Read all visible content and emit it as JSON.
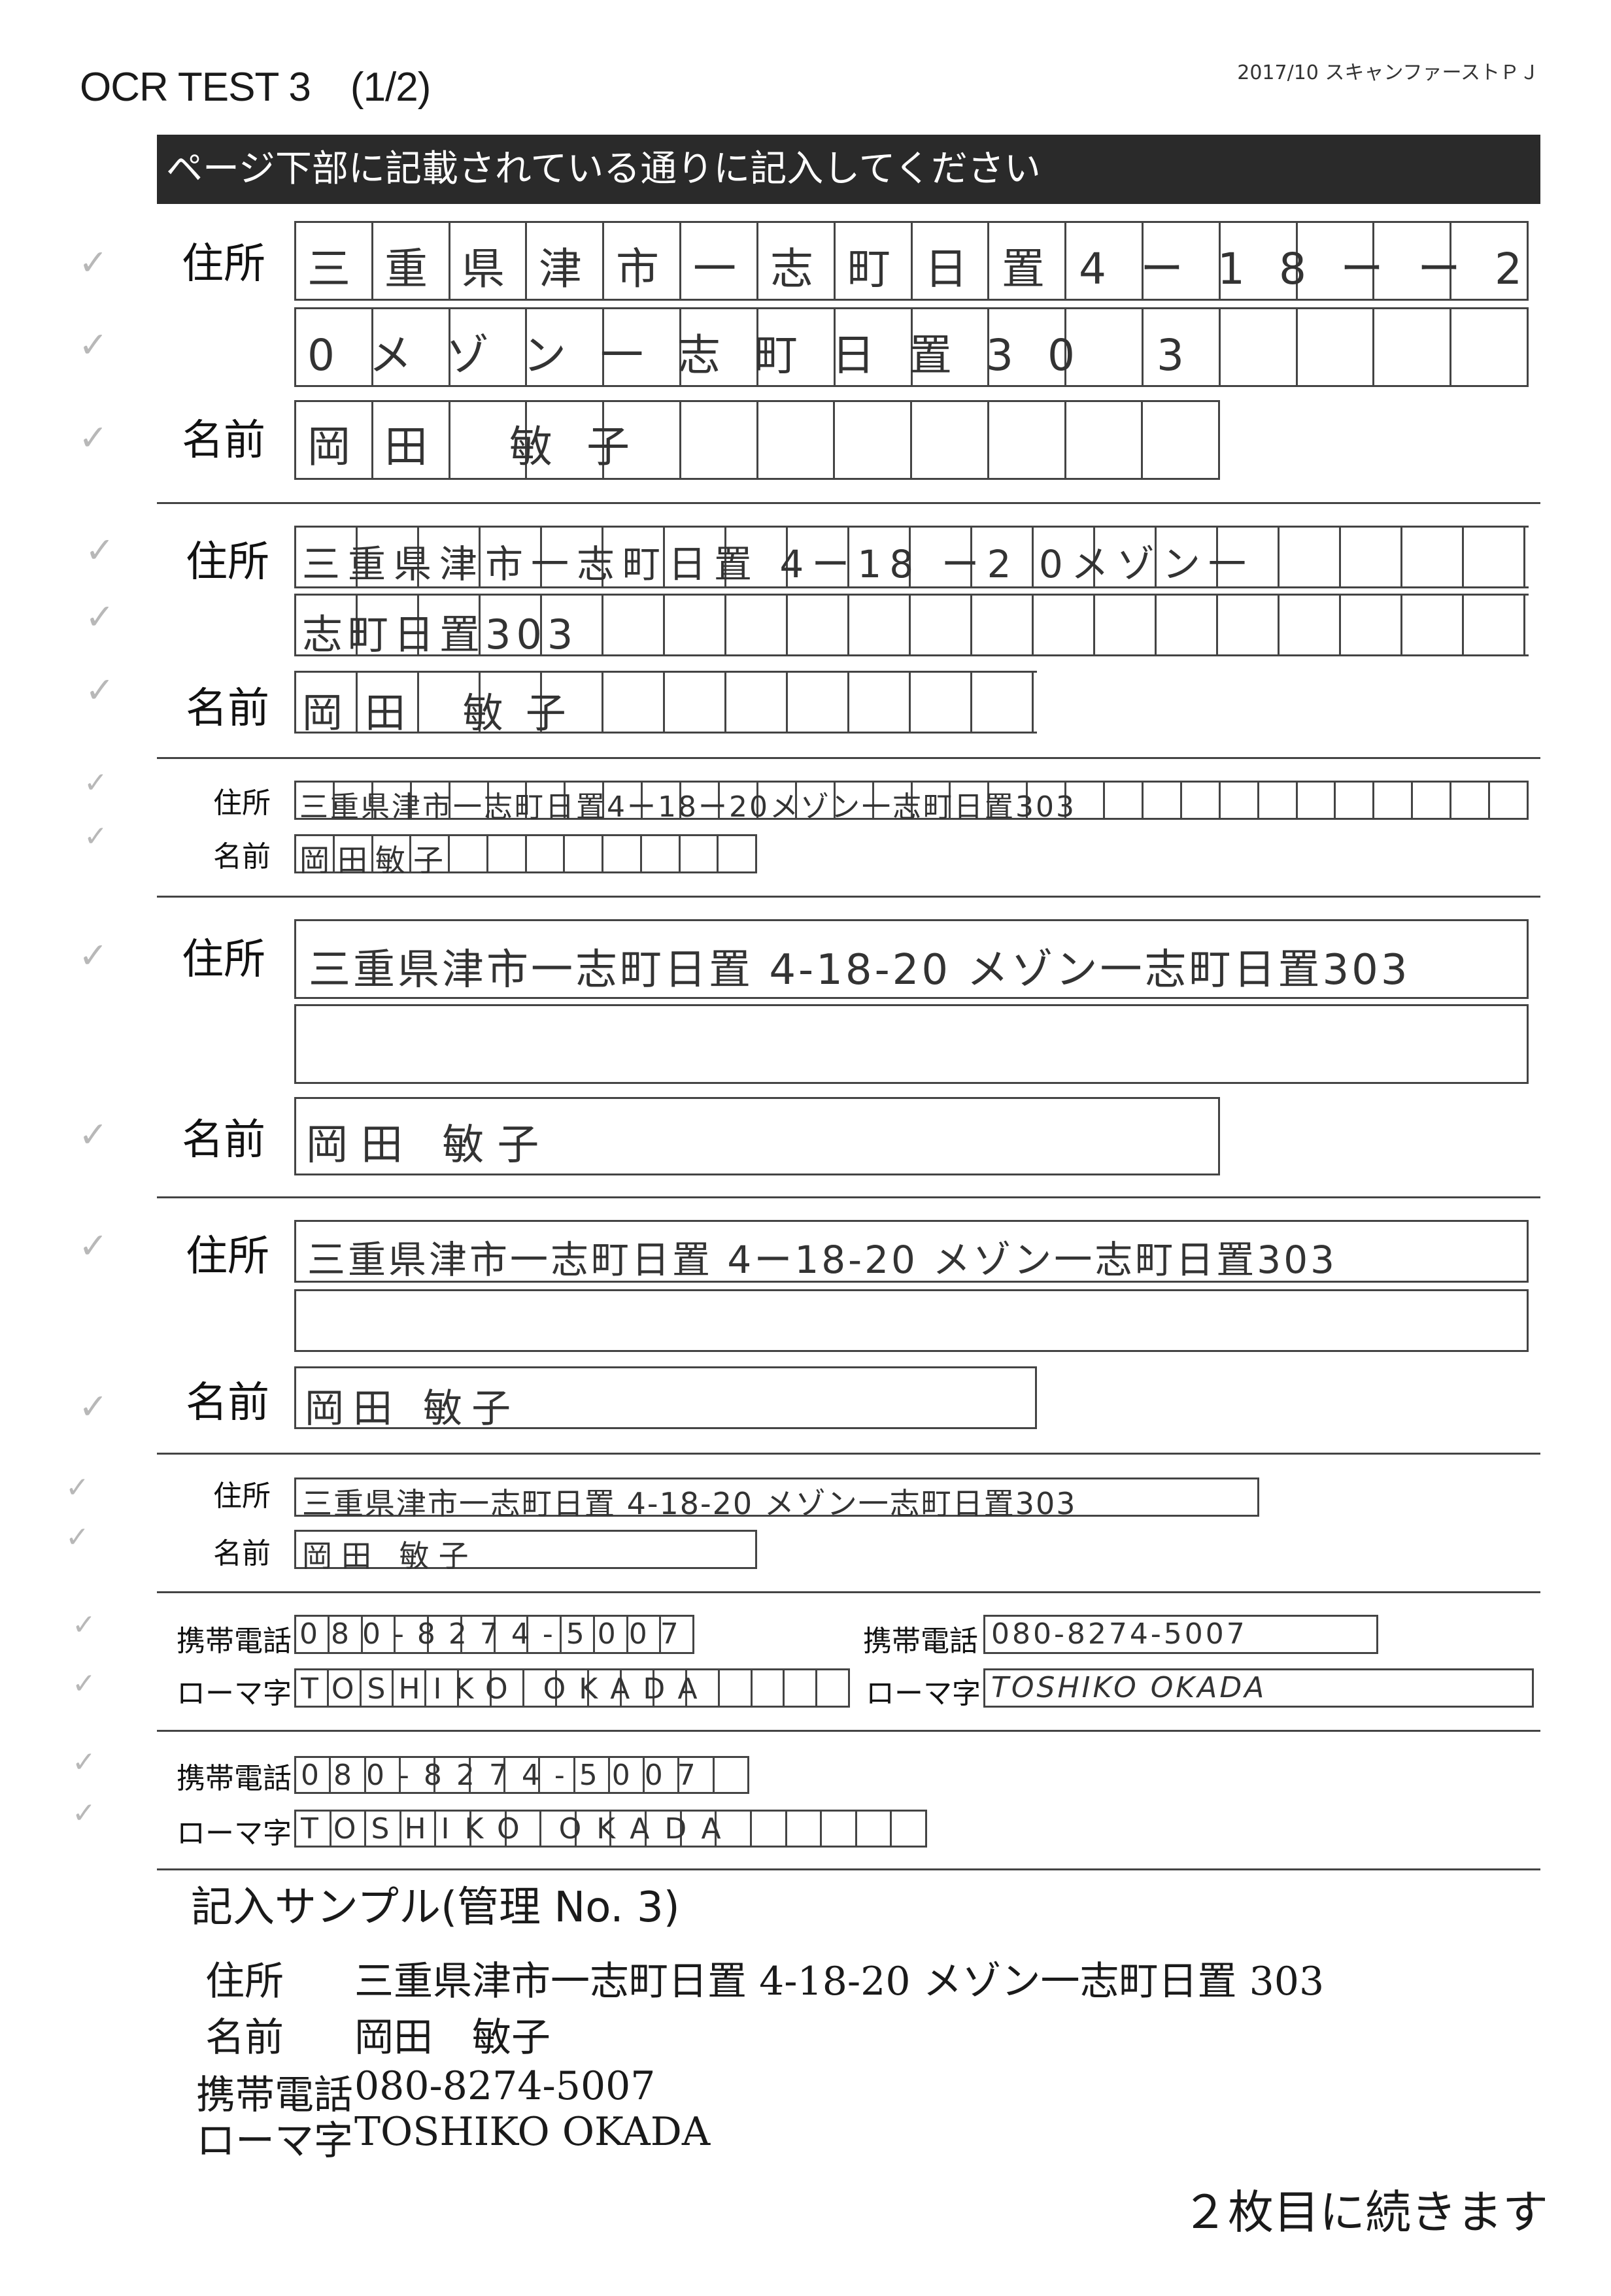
{
  "header": {
    "title": "OCR TEST 3　(1/2)",
    "project": "2017/10 スキャンファーストＰＪ",
    "instruction": "ページ下部に記載されている通りに記入してください"
  },
  "labels": {
    "address": "住所",
    "name": "名前",
    "mobile": "携帯電話",
    "romaji": "ローマ字"
  },
  "check_mark": "✓",
  "handwritten": {
    "s1_addr1": "三重県津市一志町日置4ー18ーー2",
    "s1_addr2": "0メゾン一志町日置30 3",
    "s1_name": "岡田  敏子",
    "s2_addr1": "三重県津市一志町日置 4ー18 ー2 0メゾン一",
    "s2_addr2": "志町日置303",
    "s2_name": "岡田 敏子",
    "s3_addr": "三重県津市一志町日置4ー18ー20メゾン一志町日置303",
    "s3_name": "岡田敏子",
    "s4_addr1": "三重県津市一志町日置 4-18-20 メゾン一志町日置303",
    "s4_name": "岡田 敏子",
    "s5_addr1": "三重県津市一志町日置 4ー18-20 メゾン一志町日置303",
    "s5_name": "岡田 敏子",
    "s6_addr": "三重県津市一志町日置 4-18-20 メゾン一志町日置303",
    "s6_name": "岡田 敏子",
    "p1_mobile": "080-8274-5007",
    "p1_romaji": "TOSHIKO OKADA",
    "p2_mobile": "080-8274-5007",
    "p2_romaji": "TOSHIKO OKADA",
    "p3_mobile": "080-8274-5007",
    "p3_romaji": "TOSHIKO OKADA"
  },
  "sample": {
    "heading": "記入サンプル(管理 No. 3)",
    "address_label": "住所",
    "address_value": "三重県津市一志町日置 4-18-20 メゾン一志町日置 303",
    "name_label": "名前",
    "name_value": "岡田　敏子",
    "mobile_label": "携帯電話",
    "mobile_value": "080-8274-5007",
    "romaji_label": "ローマ字",
    "romaji_value": "TOSHIKO OKADA"
  },
  "footer": {
    "continue": "２枚目に続きます"
  }
}
